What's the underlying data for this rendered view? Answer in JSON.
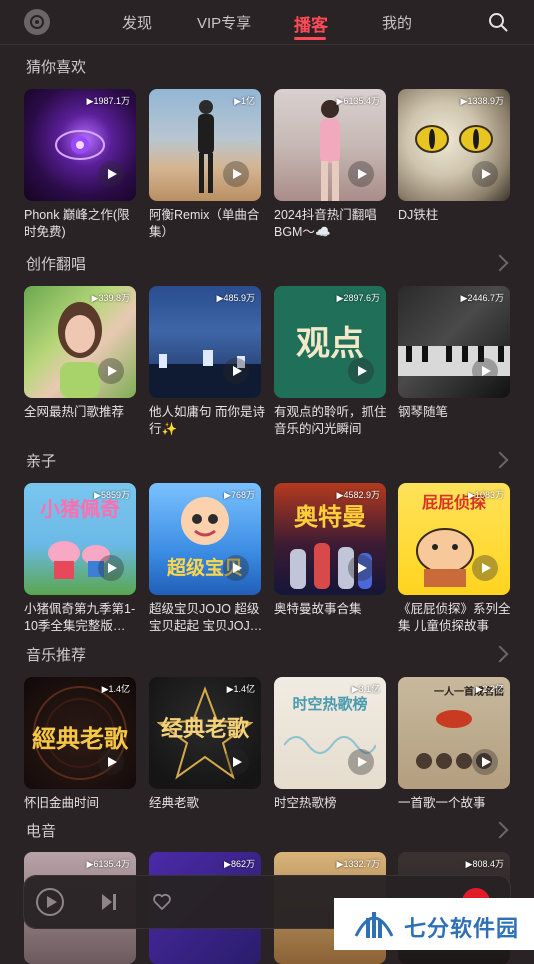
{
  "nav": {
    "tabs": [
      "发现",
      "VIP专享",
      "播客",
      "我的"
    ],
    "active_tab": "播客"
  },
  "sections": [
    {
      "title": "猜你喜欢",
      "has_arrow": false,
      "cards": [
        {
          "count": "1987.1万",
          "title": "Phonk 巅峰之作(限时免费)",
          "cover_text": ""
        },
        {
          "count": "1亿",
          "title": "阿衡Remix（单曲合集）",
          "cover_text": ""
        },
        {
          "count": "6135.4万",
          "title": "2024抖音热门翻唱BGM～☁️",
          "cover_text": ""
        },
        {
          "count": "1338.9万",
          "title": "DJ铁柱",
          "cover_text": ""
        }
      ]
    },
    {
      "title": "创作翻唱",
      "has_arrow": true,
      "cards": [
        {
          "count": "339.8万",
          "title": "全网最热门歌推荐",
          "cover_text": ""
        },
        {
          "count": "485.9万",
          "title": "他人如庸句 而你是诗行✨",
          "cover_text": ""
        },
        {
          "count": "2897.6万",
          "title": "有观点的聆听，抓住音乐的闪光瞬间",
          "cover_text": "观点"
        },
        {
          "count": "2446.7万",
          "title": "钢琴随笔",
          "cover_text": ""
        }
      ]
    },
    {
      "title": "亲子",
      "has_arrow": true,
      "cards": [
        {
          "count": "5859万",
          "title": "小猪佩奇第九季第1-10季全集完整版…",
          "cover_text": "小猪佩奇"
        },
        {
          "count": "768万",
          "title": "超级宝贝JOJO 超级宝贝起起 宝贝JOJ…",
          "cover_text": "超级宝贝"
        },
        {
          "count": "4582.9万",
          "title": "奥特曼故事合集",
          "cover_text": "奥特曼"
        },
        {
          "count": "1083万",
          "title": "《屁屁侦探》系列全集 儿童侦探故事",
          "cover_text": "屁屁侦探"
        }
      ]
    },
    {
      "title": "音乐推荐",
      "has_arrow": true,
      "cards": [
        {
          "count": "1.4亿",
          "title": "怀旧金曲时间",
          "cover_text": "經典老歌"
        },
        {
          "count": "1.4亿",
          "title": "经典老歌",
          "cover_text": "经典老歌"
        },
        {
          "count": "3.1亿",
          "title": "时空热歌榜",
          "cover_text": "时空热歌榜"
        },
        {
          "count": "2.2亿",
          "title": "一首歌一个故事",
          "cover_text": "一人一首成名曲"
        }
      ]
    },
    {
      "title": "电音",
      "has_arrow": true,
      "cards": [
        {
          "count": "6135.4万",
          "title": "",
          "cover_text": ""
        },
        {
          "count": "862万",
          "title": "",
          "cover_text": ""
        },
        {
          "count": "1332.7万",
          "title": "",
          "cover_text": ""
        },
        {
          "count": "808.4万",
          "title": "",
          "cover_text": ""
        }
      ]
    }
  ],
  "watermark": {
    "text": "七分软件园"
  },
  "colors": {
    "accent": "#ff4a57",
    "background": "#2a2325"
  }
}
